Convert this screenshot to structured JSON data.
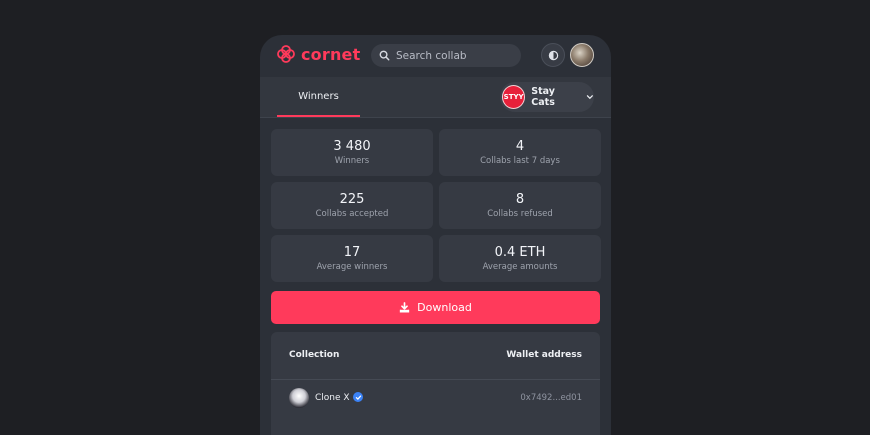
{
  "app": {
    "name": "cornet"
  },
  "header": {
    "search_placeholder": "Search collab"
  },
  "tabs": [
    {
      "label": "Winners",
      "active": true
    }
  ],
  "project_selector": {
    "logo_text": "STYY",
    "name": "Stay Cats"
  },
  "stats": [
    {
      "value": "3 480",
      "label": "Winners"
    },
    {
      "value": "4",
      "label": "Collabs last 7 days"
    },
    {
      "value": "225",
      "label": "Collabs accepted"
    },
    {
      "value": "8",
      "label": "Collabs refused"
    },
    {
      "value": "17",
      "label": "Average winners"
    },
    {
      "value": "0.4 ETH",
      "label": "Average amounts"
    }
  ],
  "download": {
    "label": "Download"
  },
  "table": {
    "columns": [
      "Collection",
      "Wallet address"
    ],
    "rows": [
      {
        "collection": "Clone X",
        "verified": true,
        "wallet": "0x7492...ed01"
      }
    ]
  },
  "colors": {
    "accent": "#ff3a5b",
    "background": "#1e1f23",
    "card": "#2c3038"
  }
}
